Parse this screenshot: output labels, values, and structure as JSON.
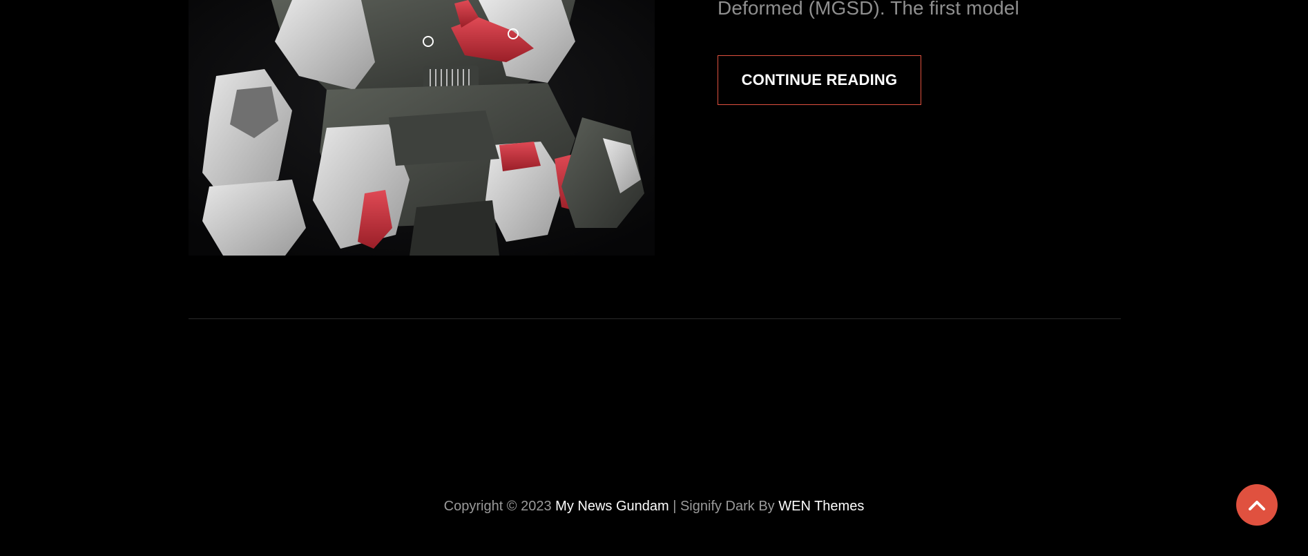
{
  "post": {
    "excerpt": "Deformed (MGSD). The first model",
    "continue_label": "CONTINUE READING",
    "image_alt": "Gundam model kit close-up"
  },
  "footer": {
    "copyright_prefix": "Copyright © 2023 ",
    "site_name": "My News Gundam",
    "separator": " | Signify Dark By ",
    "theme_author": "WEN Themes"
  },
  "scroll_top": {
    "icon": "chevron-up-icon"
  },
  "colors": {
    "background": "#000000",
    "accent": "#e0513f",
    "muted_text": "#8f8f8f",
    "link_text": "#ffffff"
  }
}
